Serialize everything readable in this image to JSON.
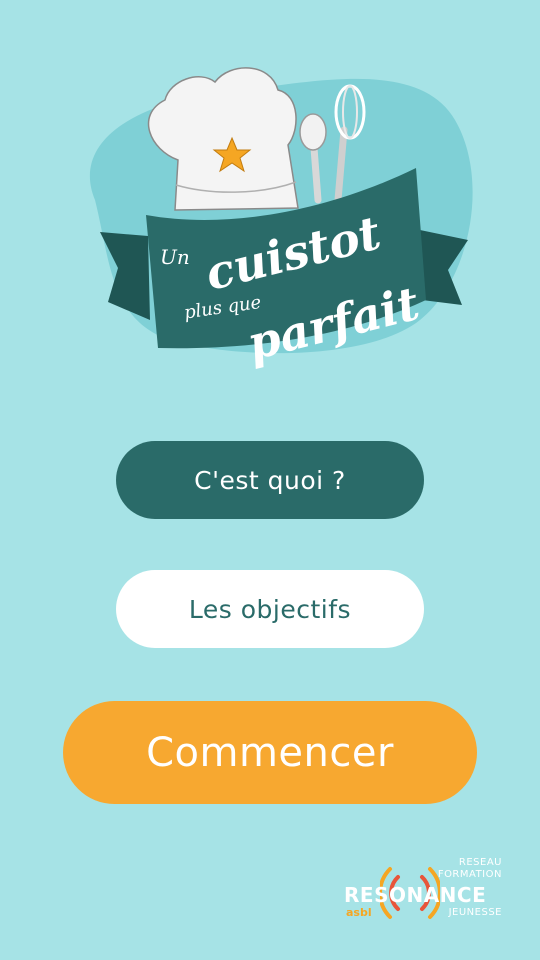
{
  "logo": {
    "line_un": "Un",
    "line_cuistot": "cuistot",
    "line_plus_que": "plus que",
    "line_parfait": "parfait"
  },
  "menu": {
    "what_label": "C'est quoi ?",
    "goals_label": "Les objectifs",
    "start_label": "Commencer"
  },
  "partner": {
    "line1": "RESEAU",
    "line2": "FORMATION",
    "name": "RESONANCE",
    "line3": "JEUNESSE",
    "asbl": "asbl"
  },
  "colors": {
    "background": "#a6e3e6",
    "teal": "#2a6b69",
    "orange": "#f7a830",
    "white": "#ffffff"
  }
}
